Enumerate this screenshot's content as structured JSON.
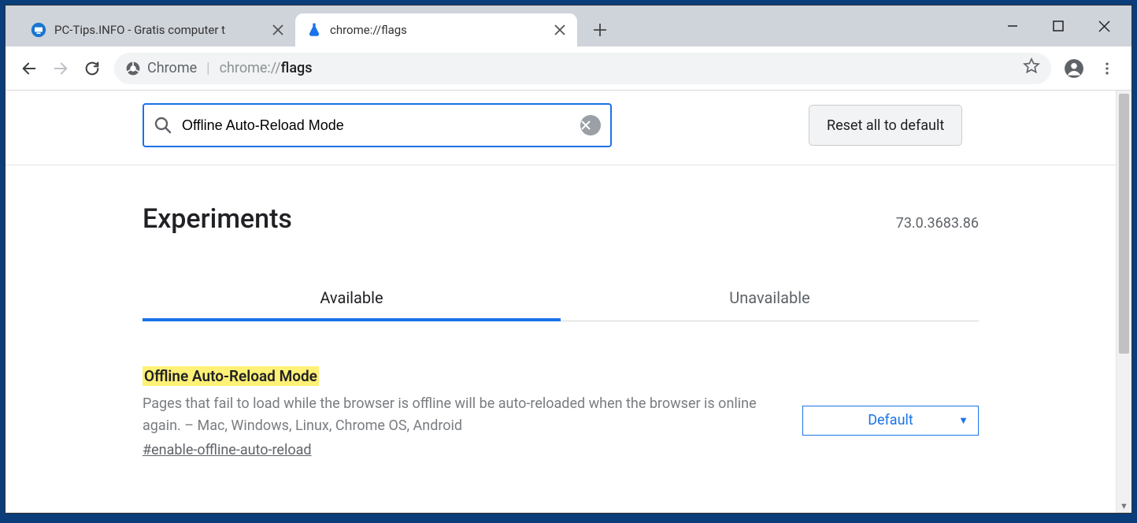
{
  "tabs": [
    {
      "title": "PC-Tips.INFO - Gratis computer t",
      "active": false
    },
    {
      "title": "chrome://flags",
      "active": true
    }
  ],
  "address_bar": {
    "chip_label": "Chrome",
    "url_prefix": "chrome://",
    "url_path": "flags"
  },
  "flags_page": {
    "search_value": "Offline Auto-Reload Mode",
    "reset_label": "Reset all to default",
    "heading": "Experiments",
    "version": "73.0.3683.86",
    "tabs": {
      "available": "Available",
      "unavailable": "Unavailable"
    },
    "item": {
      "title": "Offline Auto-Reload Mode",
      "description": "Pages that fail to load while the browser is offline will be auto-reloaded when the browser is online again. – Mac, Windows, Linux, Chrome OS, Android",
      "hash": "#enable-offline-auto-reload",
      "select_value": "Default"
    }
  }
}
